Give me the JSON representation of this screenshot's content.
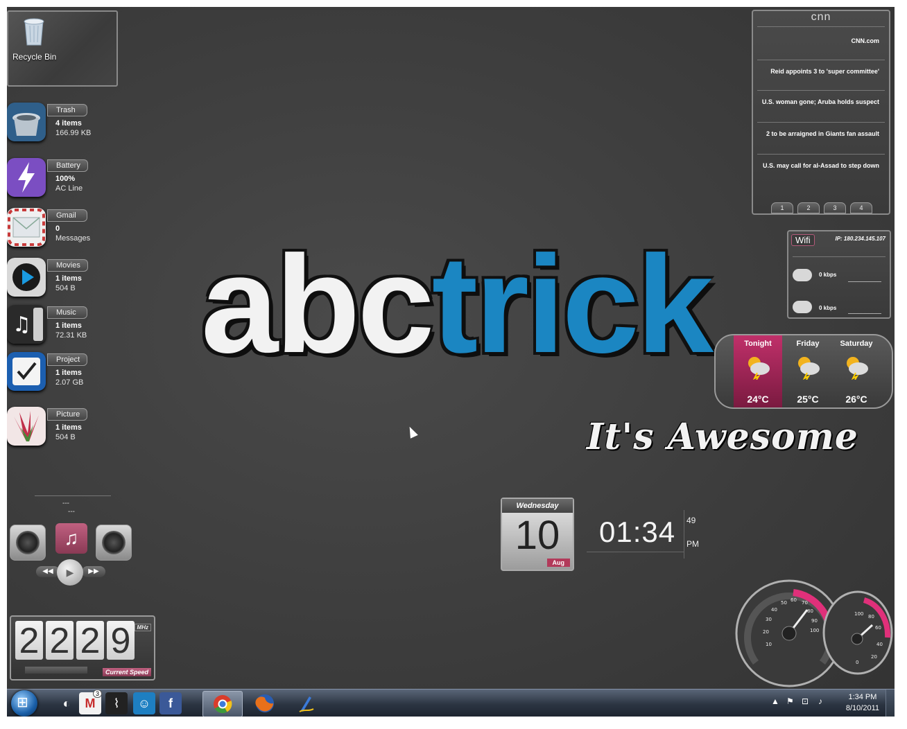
{
  "desktop": {
    "recycle_bin": {
      "label": "Recycle Bin",
      "icon": "recycle-bin-icon"
    },
    "logo": {
      "part1": "abc",
      "part2": "trick"
    },
    "tagline": "It's Awesome"
  },
  "left_widgets": [
    {
      "name": "trash",
      "tag": "Trash",
      "line1": "4 items",
      "line2": "166.99 KB",
      "icon": "trash-icon"
    },
    {
      "name": "battery",
      "tag": "Battery",
      "line1": "100%",
      "line2": "AC Line",
      "icon": "battery-icon"
    },
    {
      "name": "gmail",
      "tag": "Gmail",
      "line1": "0",
      "line2": "Messages",
      "icon": "mail-icon"
    },
    {
      "name": "movies",
      "tag": "Movies",
      "line1": "1 items",
      "line2": "504 B",
      "icon": "play-icon"
    },
    {
      "name": "music",
      "tag": "Music",
      "line1": "1 items",
      "line2": "72.31 KB",
      "icon": "music-icon"
    },
    {
      "name": "project",
      "tag": "Project",
      "line1": "1 items",
      "line2": "2.07 GB",
      "icon": "checkbox-icon"
    },
    {
      "name": "picture",
      "tag": "Picture",
      "line1": "1 items",
      "line2": "504 B",
      "icon": "picture-icon"
    }
  ],
  "cnn": {
    "title": "cnn",
    "items": [
      "CNN.com",
      "Reid appoints 3 to 'super committee'",
      "U.S. woman gone; Aruba holds suspect",
      "2 to be arraigned in Giants fan assault",
      "U.S. may call for al-Assad to step down"
    ],
    "pages": [
      "1",
      "2",
      "3",
      "4"
    ]
  },
  "wifi": {
    "label": "Wifi",
    "ip": "IP: 180.234.145.107",
    "download": "0 kbps",
    "upload": "0 kbps"
  },
  "weather": [
    {
      "day": "Tonight",
      "temp": "24°C",
      "highlight": true
    },
    {
      "day": "Friday",
      "temp": "25°C",
      "highlight": false
    },
    {
      "day": "Saturday",
      "temp": "26°C",
      "highlight": false
    }
  ],
  "calendar": {
    "weekday": "Wednesday",
    "day": "10",
    "month": "Aug"
  },
  "clock": {
    "time": "01:34",
    "seconds": "49",
    "ampm": "PM"
  },
  "player": {
    "line1": "---",
    "line2": "---"
  },
  "cpu": {
    "digits": [
      "2",
      "2",
      "2",
      "9"
    ],
    "unit": "MHz",
    "label": "Current Speed"
  },
  "taskbar": {
    "gmail_badge": "3",
    "time": "1:34 PM",
    "date": "8/10/2011"
  },
  "colors": {
    "accent_blue": "#1b86c2",
    "accent_pink": "#b23a5a",
    "desktop_bg": "#3d3d3d"
  }
}
